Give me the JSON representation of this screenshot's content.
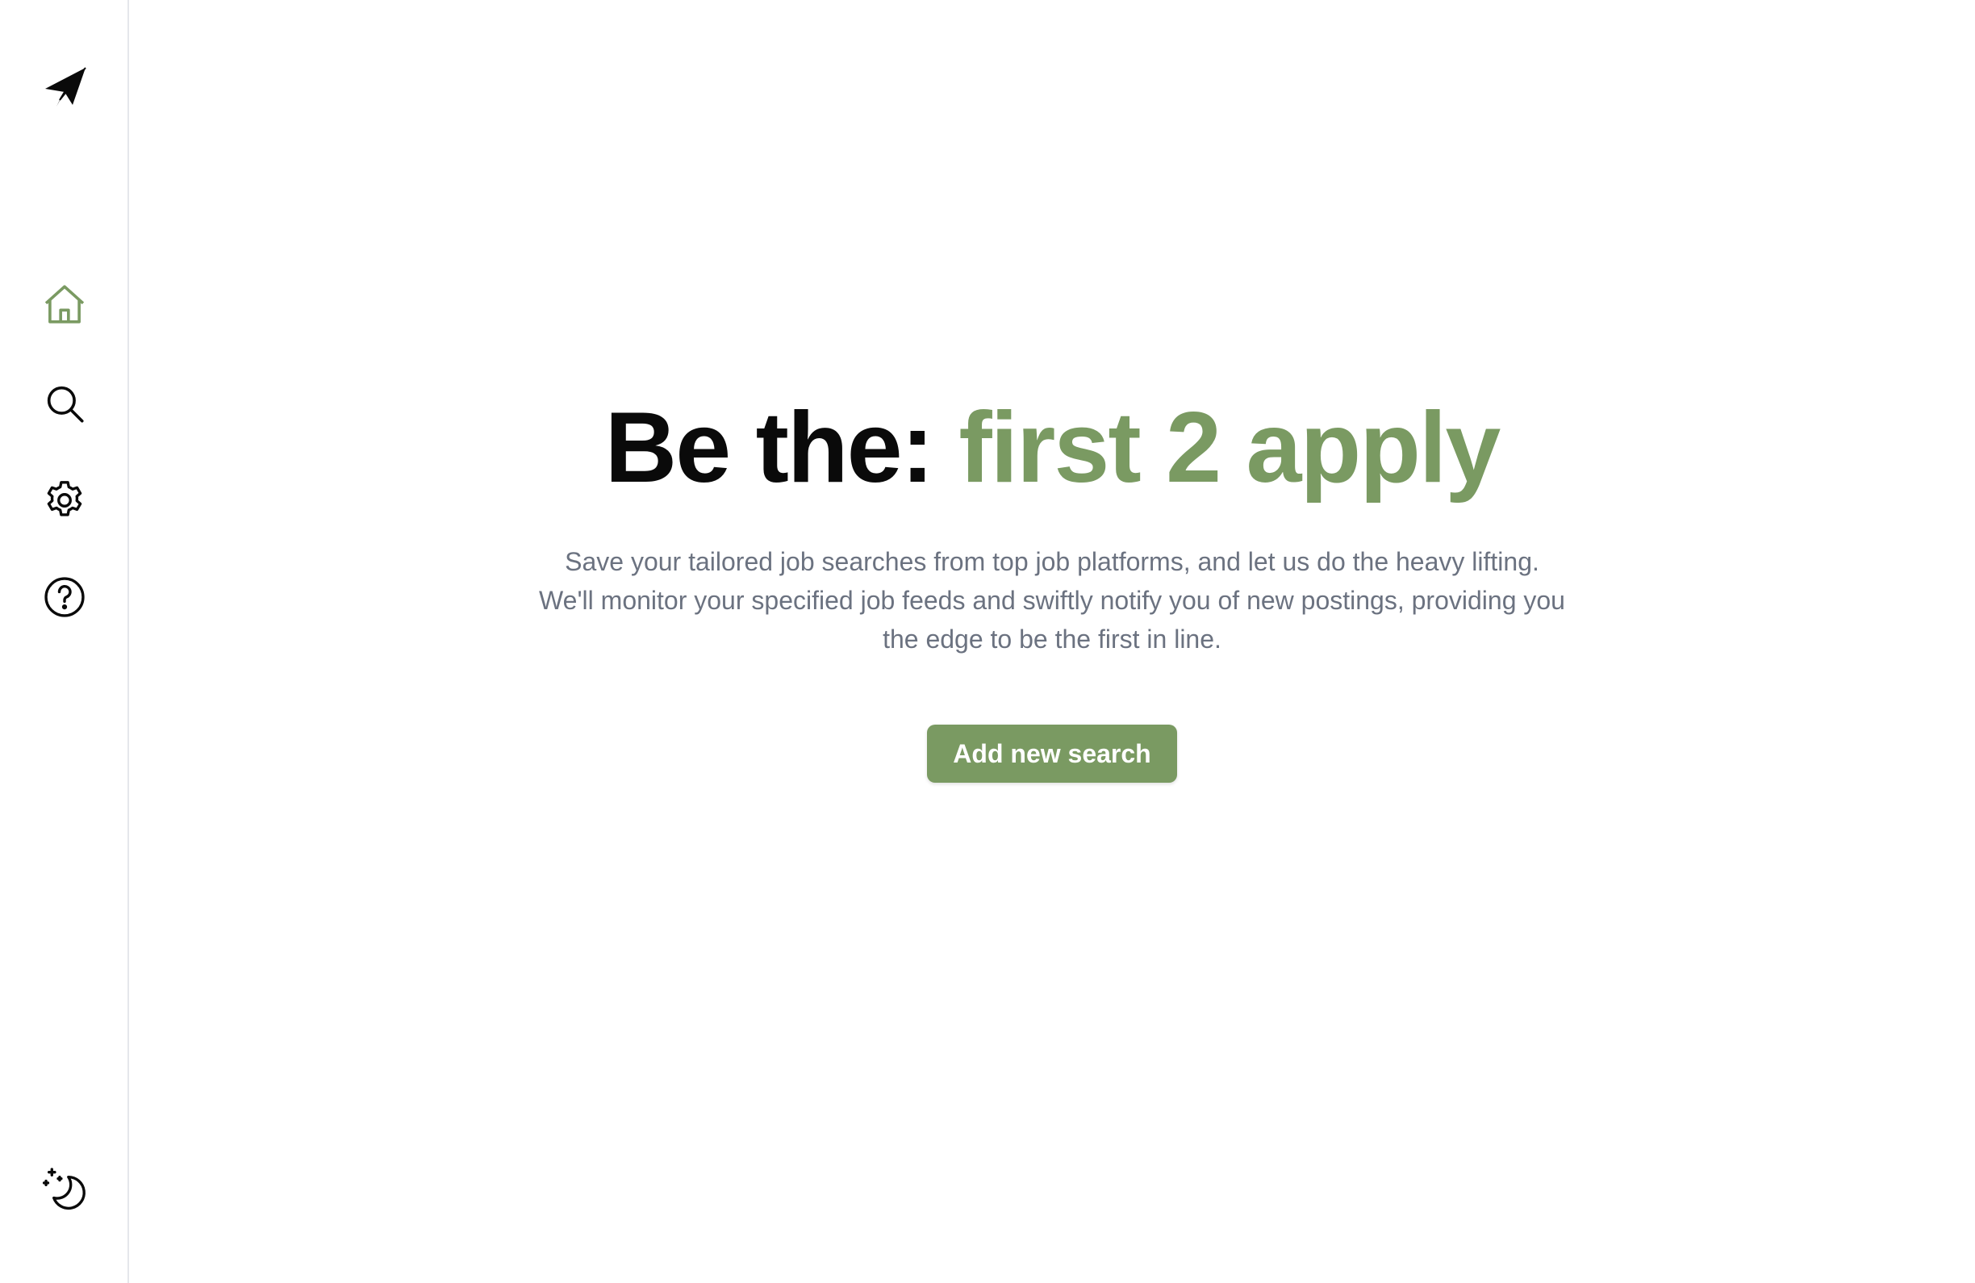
{
  "sidebar": {
    "logo_icon": "paper-plane-icon",
    "items": [
      {
        "id": "home",
        "icon": "home-icon",
        "active": true
      },
      {
        "id": "search",
        "icon": "search-icon",
        "active": false
      },
      {
        "id": "settings",
        "icon": "gear-icon",
        "active": false
      },
      {
        "id": "help",
        "icon": "help-circle-icon",
        "active": false
      }
    ],
    "theme_toggle_icon": "moon-stars-icon"
  },
  "hero": {
    "title_prefix": "Be the: ",
    "title_accent": "first 2 apply",
    "description": "Save your tailored job searches from top job platforms, and let us do the heavy lifting. We'll monitor your specified job feeds and swiftly notify you of new postings, providing you the edge to be the first in line.",
    "cta_label": "Add new search"
  },
  "colors": {
    "accent": "#7a9a62",
    "text_primary": "#0a0a0a",
    "text_muted": "#6b7280",
    "border": "#e5e7eb"
  }
}
